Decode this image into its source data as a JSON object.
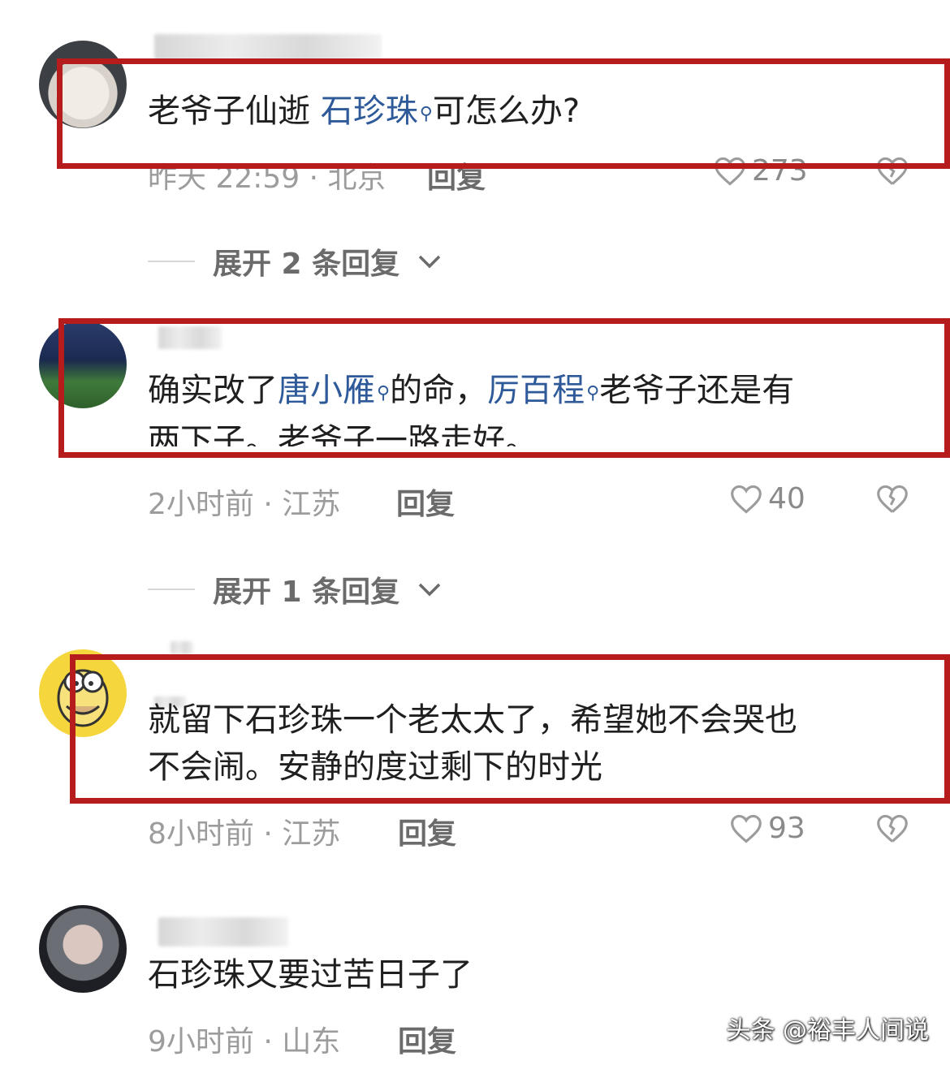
{
  "comments": [
    {
      "text_pre": "老爷子仙逝 ",
      "tag1": "石珍珠",
      "text_post": "可怎么办?",
      "meta": "昨天 22:59 · 北京",
      "reply": "回复",
      "likes": "273",
      "expand": "展开 2 条回复"
    },
    {
      "line1_pre": "确实改了",
      "tag1": "唐小雁",
      "line1_mid": "的命，",
      "tag2": "厉百程",
      "line1_post": "老爷子还是有",
      "line2": "两下子。老爷子一路走好。",
      "meta": "2小时前 · 江苏",
      "reply": "回复",
      "likes": "40",
      "expand": "展开 1 条回复"
    },
    {
      "line1": "就留下石珍珠一个老太太了，希望她不会哭也",
      "line2": "不会闹。安静的度过剩下的时光",
      "meta": "8小时前 · 江苏",
      "reply": "回复",
      "likes": "93"
    },
    {
      "line1": "石珍珠又要过苦日子了",
      "meta": "9小时前 · 山东",
      "reply": "回复"
    }
  ],
  "watermark": "头条 @裕丰人间说",
  "colors": {
    "highlight_box": "#b71c1c",
    "tag": "#2f5a9a"
  },
  "icons": {
    "like": "heart-outline-icon",
    "dislike": "broken-heart-icon",
    "tag": "search-icon",
    "expand": "chevron-down-icon"
  }
}
